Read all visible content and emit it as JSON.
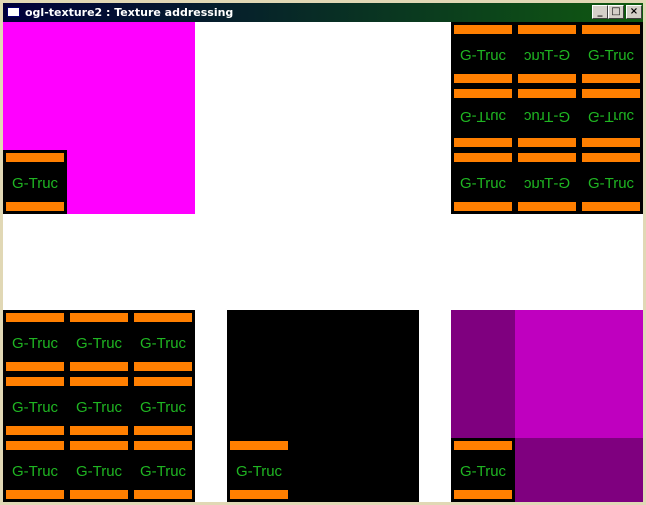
{
  "window": {
    "title": "ogl-texture2 : Texture addressing",
    "app_icon": "window-icon",
    "buttons": {
      "minimize": "_",
      "maximize": "□",
      "close": "×"
    }
  },
  "texture": {
    "label": "G-Truc",
    "colors": {
      "bar": "#ff7f00",
      "text": "#1fb522",
      "tile_bg": "#000000"
    }
  },
  "views": [
    {
      "name": "clamp-to-border-magenta",
      "border_color": "#ff00ff"
    },
    {
      "name": "mirrored-repeat"
    },
    {
      "name": "repeat"
    },
    {
      "name": "clamp-to-border-black",
      "border_color": "#000000"
    },
    {
      "name": "clamp-to-edge-purple",
      "colors": [
        "#7f007f",
        "#bf00bf"
      ]
    }
  ]
}
